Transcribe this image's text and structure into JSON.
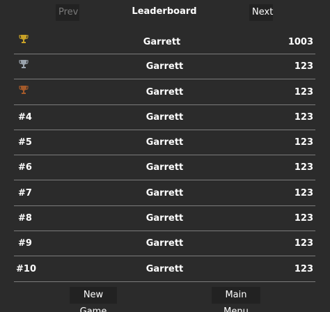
{
  "header": {
    "prev_label": "Prev",
    "title": "Leaderboard",
    "next_label": "Next"
  },
  "rows": [
    {
      "rank": "",
      "trophy": "gold-trophy-icon",
      "name": "Garrett",
      "score": "1003"
    },
    {
      "rank": "",
      "trophy": "silver-trophy-icon",
      "name": "Garrett",
      "score": "123"
    },
    {
      "rank": "",
      "trophy": "bronze-trophy-icon",
      "name": "Garrett",
      "score": "123"
    },
    {
      "rank": "#4",
      "name": "Garrett",
      "score": "123"
    },
    {
      "rank": "#5",
      "name": "Garrett",
      "score": "123"
    },
    {
      "rank": "#6",
      "name": "Garrett",
      "score": "123"
    },
    {
      "rank": "#7",
      "name": "Garrett",
      "score": "123"
    },
    {
      "rank": "#8",
      "name": "Garrett",
      "score": "123"
    },
    {
      "rank": "#9",
      "name": "Garrett",
      "score": "123"
    },
    {
      "rank": "#10",
      "name": "Garrett",
      "score": "123"
    }
  ],
  "footer": {
    "new_game_label": "New Game",
    "main_menu_label": "Main Menu"
  },
  "colors": {
    "background": "#2b2b2b",
    "button_bg": "#222222",
    "divider": "#7c7c7c",
    "gold": "#c9a227",
    "silver": "#9aa3ad",
    "bronze": "#a45a2a",
    "disabled_text": "#7a7a7a"
  }
}
